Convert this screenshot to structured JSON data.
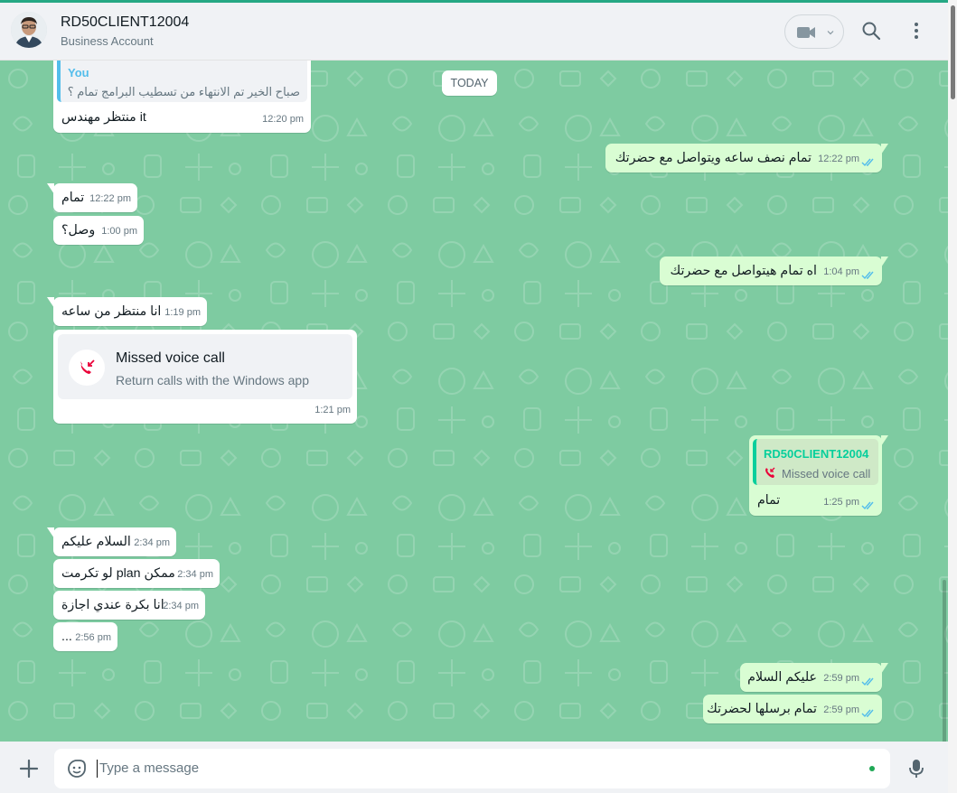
{
  "header": {
    "title": "RD50CLIENT12004",
    "subtitle": "Business Account"
  },
  "chat": {
    "date_divider": "TODAY",
    "quoted_top": {
      "author": "You",
      "text": "صباح الخير تم الانتهاء من تسطيب البرامج تمام ؟"
    },
    "messages": [
      {
        "dir": "in",
        "text": "منتظر مهندس it",
        "time": "12:20 pm"
      },
      {
        "dir": "out",
        "text": "تمام نصف ساعه ويتواصل مع حضرتك",
        "time": "12:22 pm"
      },
      {
        "dir": "in",
        "text": "تمام",
        "time": "12:22 pm"
      },
      {
        "dir": "in",
        "text": "وصل؟",
        "time": "1:00 pm"
      },
      {
        "dir": "out",
        "text": "اه تمام هيتواصل مع حضرتك",
        "time": "1:04 pm"
      },
      {
        "dir": "in",
        "text": "انا منتظر من ساعه",
        "time": "1:19 pm"
      },
      {
        "dir": "in",
        "type": "missed_call",
        "title": "Missed voice call",
        "subtitle": "Return calls with the Windows app",
        "time": "1:21 pm"
      },
      {
        "dir": "out",
        "quote_author": "RD50CLIENT12004",
        "quote_text": "Missed voice call",
        "text": "تمام",
        "time": "1:25 pm"
      },
      {
        "dir": "in",
        "text": "السلام عليكم",
        "time": "2:34 pm"
      },
      {
        "dir": "in",
        "text": "ممكن plan لو تكرمت",
        "time": "2:34 pm"
      },
      {
        "dir": "in",
        "text": "انا بكرة عندي اجازة",
        "time": "2:34 pm"
      },
      {
        "dir": "in",
        "text": "...",
        "time": "2:56 pm"
      },
      {
        "dir": "out",
        "text": "عليكم السلام",
        "time": "2:59 pm"
      },
      {
        "dir": "out",
        "text": "تمام برسلها لحضرتك",
        "time": "2:59 pm"
      }
    ]
  },
  "composer": {
    "placeholder": "Type a message"
  },
  "colors": {
    "chat_bg": "#7ecba1",
    "out_bubble": "#d9fdd3",
    "accent": "#25a884",
    "tick_blue": "#53bdeb",
    "missed_red": "#ea0038"
  },
  "icons": [
    "avatar",
    "video-call-icon",
    "chevron-down-icon",
    "search-icon",
    "menu-icon",
    "missed-call-icon",
    "read-tick-icon",
    "plus-icon",
    "sticker-icon",
    "mic-icon"
  ]
}
